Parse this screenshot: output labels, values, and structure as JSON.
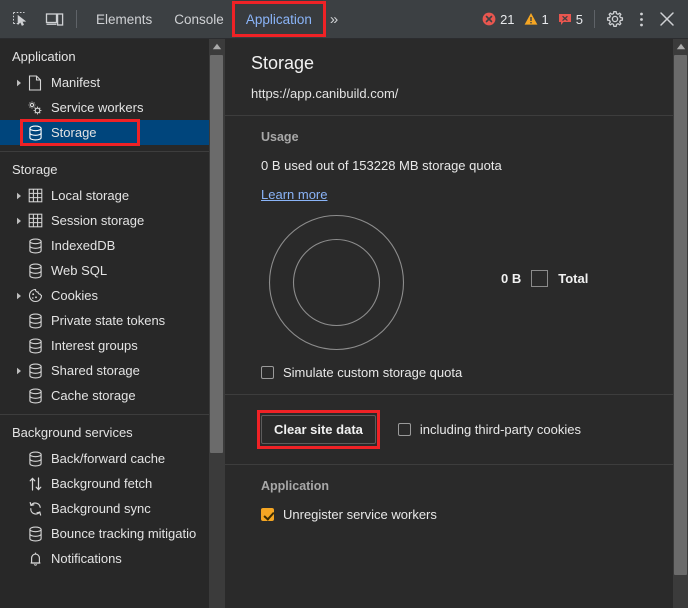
{
  "toolbar": {
    "inspect_icon": "inspect-element-icon",
    "device_icon": "device-toolbar-icon",
    "tabs": [
      {
        "label": "Elements",
        "selected": false
      },
      {
        "label": "Console",
        "selected": false
      },
      {
        "label": "Application",
        "selected": true
      }
    ],
    "more_tabs_label": "»",
    "badges": [
      {
        "icon": "error-icon",
        "count": "21",
        "color": "#e8564f"
      },
      {
        "icon": "warning-icon",
        "count": "1",
        "color": "#f5a623"
      },
      {
        "icon": "issue-icon",
        "count": "5",
        "color": "#e8564f"
      }
    ],
    "settings_icon": "gear-icon",
    "more_icon": "kebab-menu-icon",
    "close_icon": "close-icon"
  },
  "sidebar": {
    "sections": [
      {
        "title": "Application",
        "items": [
          {
            "label": "Manifest",
            "icon": "document-icon",
            "expandable": true,
            "selected": false
          },
          {
            "label": "Service workers",
            "icon": "gears-icon",
            "expandable": false,
            "selected": false
          },
          {
            "label": "Storage",
            "icon": "database-icon",
            "expandable": false,
            "selected": true
          }
        ]
      },
      {
        "title": "Storage",
        "items": [
          {
            "label": "Local storage",
            "icon": "table-icon",
            "expandable": true,
            "selected": false
          },
          {
            "label": "Session storage",
            "icon": "table-icon",
            "expandable": true,
            "selected": false
          },
          {
            "label": "IndexedDB",
            "icon": "database-icon",
            "expandable": false,
            "selected": false
          },
          {
            "label": "Web SQL",
            "icon": "database-icon",
            "expandable": false,
            "selected": false
          },
          {
            "label": "Cookies",
            "icon": "cookie-icon",
            "expandable": true,
            "selected": false
          },
          {
            "label": "Private state tokens",
            "icon": "database-icon",
            "expandable": false,
            "selected": false
          },
          {
            "label": "Interest groups",
            "icon": "database-icon",
            "expandable": false,
            "selected": false
          },
          {
            "label": "Shared storage",
            "icon": "database-icon",
            "expandable": true,
            "selected": false
          },
          {
            "label": "Cache storage",
            "icon": "database-icon",
            "expandable": false,
            "selected": false
          }
        ]
      },
      {
        "title": "Background services",
        "items": [
          {
            "label": "Back/forward cache",
            "icon": "database-icon",
            "expandable": false,
            "selected": false
          },
          {
            "label": "Background fetch",
            "icon": "arrows-updown-icon",
            "expandable": false,
            "selected": false
          },
          {
            "label": "Background sync",
            "icon": "sync-icon",
            "expandable": false,
            "selected": false
          },
          {
            "label": "Bounce tracking mitigatio",
            "icon": "database-icon",
            "expandable": false,
            "selected": false
          },
          {
            "label": "Notifications",
            "icon": "bell-icon",
            "expandable": false,
            "selected": false
          }
        ]
      }
    ]
  },
  "content": {
    "title": "Storage",
    "origin": "https://app.canibuild.com/",
    "usage": {
      "heading": "Usage",
      "description": "0 B used out of 153228 MB storage quota",
      "learn_more": "Learn more",
      "chart_total_value": "0 B",
      "chart_total_label": "Total",
      "simulate_quota_label": "Simulate custom storage quota",
      "simulate_quota_checked": false
    },
    "clear": {
      "button_label": "Clear site data",
      "third_party_label": "including third-party cookies",
      "third_party_checked": false
    },
    "application": {
      "heading": "Application",
      "unregister_label": "Unregister service workers",
      "unregister_checked": true
    }
  },
  "annotations": {
    "highlight_color": "#ef2226",
    "targets": [
      "application-tab",
      "sidebar-storage-item",
      "clear-site-data-button"
    ]
  }
}
